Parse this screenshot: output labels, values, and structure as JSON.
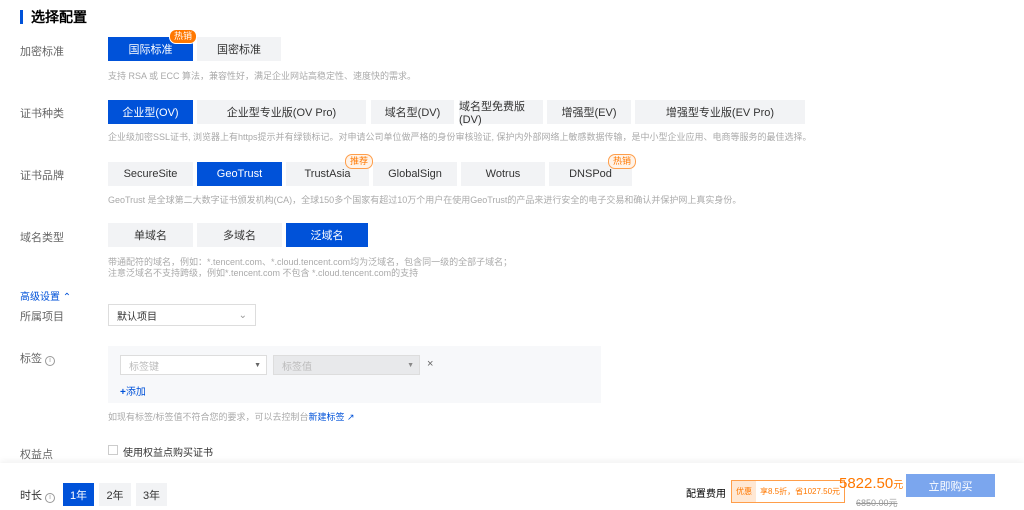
{
  "title": "选择配置",
  "encryption": {
    "label": "加密标准",
    "options": [
      "国际标准",
      "国密标准"
    ],
    "badge": "热销",
    "desc": "支持 RSA 或 ECC 算法，兼容性好，满足企业网站高稳定性、速度快的需求。"
  },
  "cert_type": {
    "label": "证书种类",
    "options": [
      "企业型(OV)",
      "企业型专业版(OV Pro)",
      "域名型(DV)",
      "域名型免费版(DV)",
      "增强型(EV)",
      "增强型专业版(EV Pro)"
    ],
    "desc": "企业级加密SSL证书, 浏览器上有https提示并有绿锁标记。对申请公司单位做严格的身份审核验证, 保护内外部网络上敏感数据传输，是中小型企业应用、电商等服务的最佳选择。"
  },
  "brand": {
    "label": "证书品牌",
    "options": [
      "SecureSite",
      "GeoTrust",
      "TrustAsia",
      "GlobalSign",
      "Wotrus",
      "DNSPod"
    ],
    "badge_recommend": "推荐",
    "badge_hot": "热销",
    "desc": "GeoTrust 是全球第二大数字证书颁发机构(CA)，全球150多个国家有超过10万个用户在使用GeoTrust的产品来进行安全的电子交易和确认并保护网上真实身份。"
  },
  "domain_type": {
    "label": "域名类型",
    "options": [
      "单域名",
      "多域名",
      "泛域名"
    ],
    "desc1": "带通配符的域名，例如：*.tencent.com、*.cloud.tencent.com均为泛域名，包含同一级的全部子域名；",
    "desc2": "注意泛域名不支持跨级，例如*.tencent.com 不包含 *.cloud.tencent.com的支持"
  },
  "advanced": {
    "label": "高级设置"
  },
  "project": {
    "label": "所属项目",
    "value": "默认项目"
  },
  "tags": {
    "label": "标签",
    "key_placeholder": "标签键",
    "value_placeholder": "标签值",
    "add": "添加",
    "hint": "如现有标签/标签值不符合您的要求，可以去控制台",
    "hint_link": "新建标签"
  },
  "points": {
    "label": "权益点",
    "checkbox": "使用权益点购买证书"
  },
  "duration": {
    "label": "时长",
    "options": [
      "1年",
      "2年",
      "3年"
    ]
  },
  "price": {
    "label": "配置费用",
    "promo_tag": "优惠",
    "promo_text": "享8.5折，省1027.50元",
    "amount": "5822.50",
    "unit": "元",
    "original": "6850.00元",
    "buy": "立即购买"
  }
}
